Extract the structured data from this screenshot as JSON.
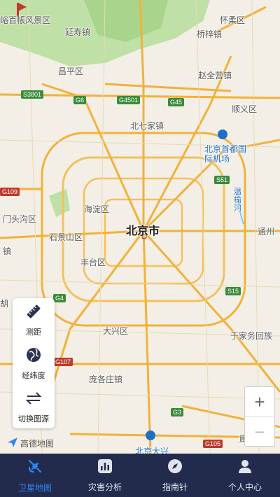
{
  "map": {
    "labels": {
      "scenic": "峪百帳风景区",
      "yanshou": "延寿镇",
      "huairou": "怀柔区",
      "qiaozi": "桥梓镇",
      "changping": "昌平区",
      "zhaoquanying": "赵全营镇",
      "shunyi": "顺义区",
      "beiqijia": "北七家镇",
      "airport": "北京首都国际机场",
      "haidian": "海淀区",
      "beijing": "北京市",
      "mentougou": "门头沟区",
      "shijingshan": "石景山区",
      "tongzhou": "通州",
      "fengtai": "丰台区",
      "zhen_left": "镇",
      "hu": "胡",
      "daxing": "大兴区",
      "yujiawu": "于家务回族",
      "pangezhuang": "庞各庄镇",
      "daxing_airport": "北京大兴",
      "langfang": "廊坊市",
      "river": "温榆河"
    },
    "roads": {
      "s3801": "S3801",
      "g6": "G6",
      "g4501": "G4501",
      "g45": "G45",
      "g109": "G109",
      "s51": "S51",
      "g4": "G4",
      "s15": "S15",
      "g107": "G107",
      "g3": "G3",
      "g105": "G105"
    },
    "attribution": "高德地图"
  },
  "tools": {
    "measure": "测距",
    "latlng": "经纬度",
    "switch_source": "切换图源"
  },
  "zoom": {
    "in": "+",
    "out": "−"
  },
  "tabs": [
    {
      "label": "卫星地图",
      "icon": "satellite-icon",
      "active": true
    },
    {
      "label": "灾害分析",
      "icon": "chart-icon",
      "active": false
    },
    {
      "label": "指南针",
      "icon": "compass-icon",
      "active": false
    },
    {
      "label": "个人中心",
      "icon": "user-icon",
      "active": false
    }
  ],
  "colors": {
    "tabbar": "#232b4d",
    "active": "#2f86f6",
    "road": "#f5b942",
    "green": "#a8d58b"
  }
}
